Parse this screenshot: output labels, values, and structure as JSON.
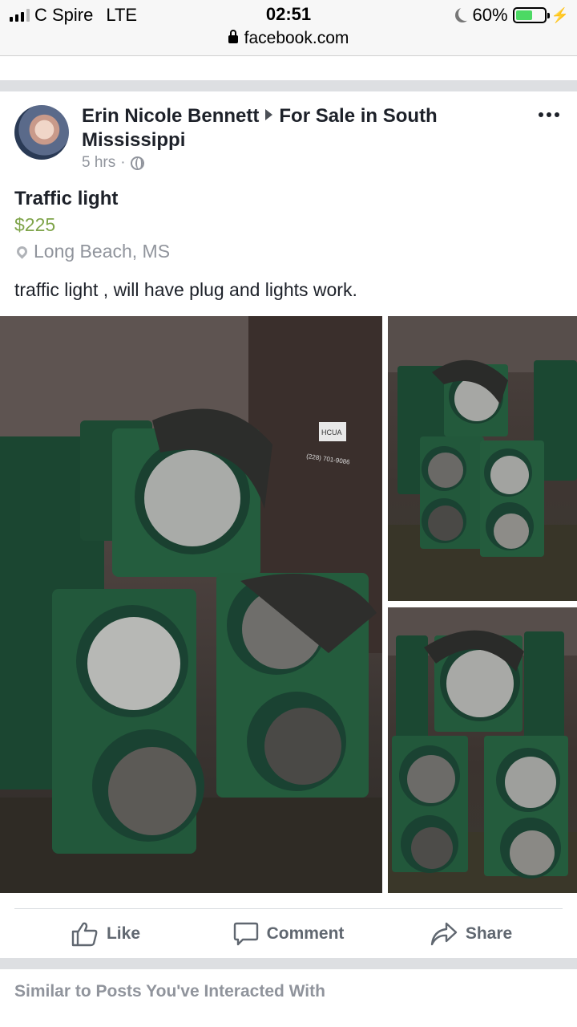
{
  "status_bar": {
    "carrier": "C Spire",
    "network": "LTE",
    "time": "02:51",
    "battery": "60%",
    "battery_level": 0.6,
    "signal_bars": 3
  },
  "url_bar": {
    "domain": "facebook.com"
  },
  "previous_post": {
    "like_label": "Like",
    "comment_label": "Comment",
    "share_label": "Share"
  },
  "post": {
    "author": "Erin Nicole Bennett",
    "group": "For Sale in South Mississippi",
    "time": "5 hrs",
    "separator": "·",
    "title": "Traffic light",
    "price": "$225",
    "location": "Long Beach, MS",
    "description": "traffic light , will have plug and lights work.",
    "photo_sign_text": "HCUA",
    "photo_sign_phone": "(228) 701-9086",
    "actions": {
      "like": "Like",
      "comment": "Comment",
      "share": "Share"
    }
  },
  "next_section": {
    "title": "Similar to Posts You've Interacted With"
  },
  "colors": {
    "price": "#7fa44a",
    "traffic_light_green": "#1f5a3a",
    "muted_text": "#90949c"
  },
  "icons": [
    "signal-icon",
    "moon-icon",
    "battery-icon",
    "lock-icon",
    "globe-icon",
    "pin-icon",
    "more-icon",
    "like-icon",
    "comment-icon",
    "share-icon"
  ]
}
